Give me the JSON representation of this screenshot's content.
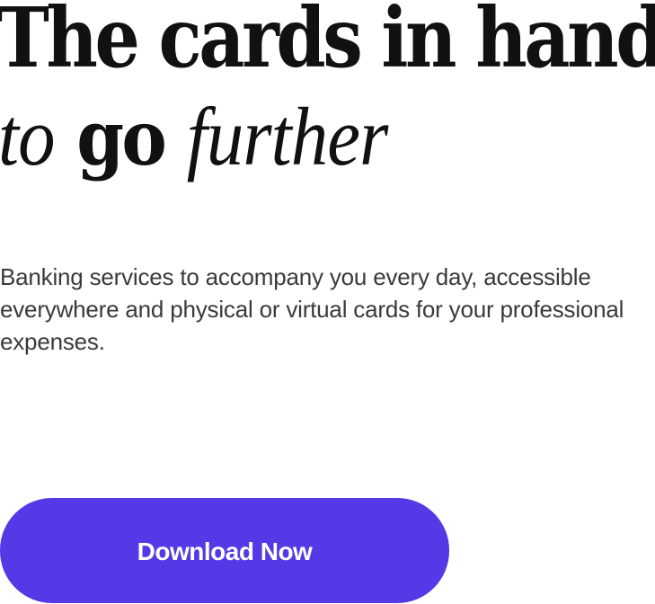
{
  "hero": {
    "title_line_1": "The cards in hand",
    "title_line_2_part_1": "to",
    "title_line_2_part_2": "go",
    "title_line_2_part_3": "further"
  },
  "subtitle": "Banking services to accompany you every day, accessible everywhere and physical or virtual cards for your professional expenses.",
  "cta": {
    "label": "Download Now",
    "color": "#5538E6"
  }
}
